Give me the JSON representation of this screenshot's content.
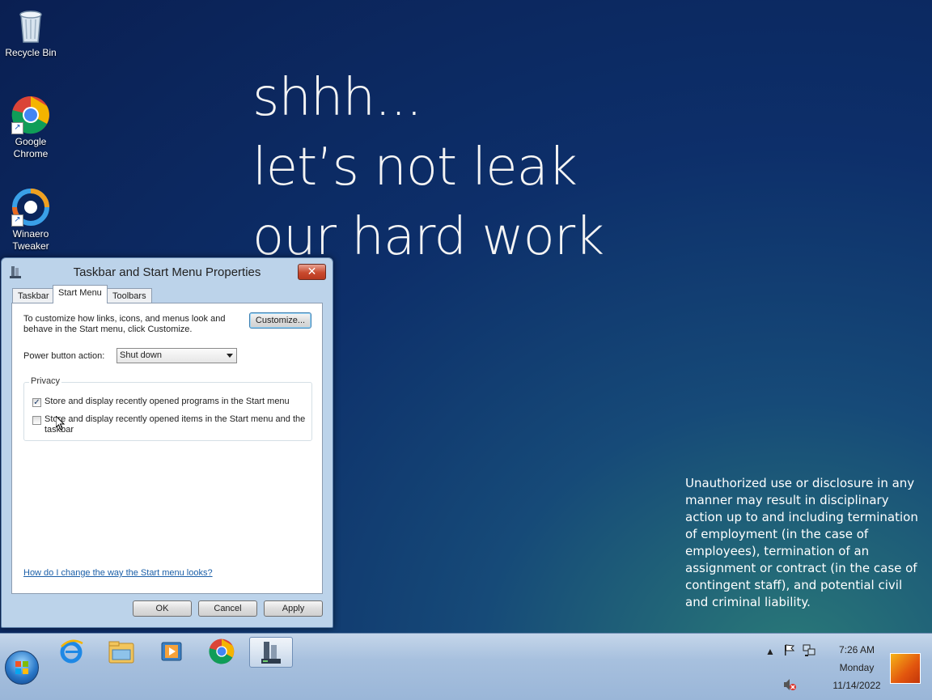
{
  "desktop": {
    "icons": [
      {
        "label": "Recycle Bin",
        "icon": "recycle-bin-icon"
      },
      {
        "label": "Google Chrome",
        "icon": "chrome-icon"
      },
      {
        "label": "Winaero Tweaker",
        "icon": "winaero-tweaker-icon"
      }
    ],
    "wallpaper_lines": [
      "shhh...",
      "let’s not leak",
      "our hard work"
    ],
    "notice": "Unauthorized use or disclosure in any manner may result in disciplinary action up to and including termination of employment (in the case of employees), termination of an assignment or contract (in the case of contingent staff), and potential civil and criminal liability."
  },
  "dialog": {
    "title": "Taskbar and Start Menu Properties",
    "close_label": "✕",
    "tabs": [
      {
        "label": "Taskbar",
        "active": false
      },
      {
        "label": "Start Menu",
        "active": true
      },
      {
        "label": "Toolbars",
        "active": false
      }
    ],
    "description": "To customize how links, icons, and menus look and behave in the Start menu, click Customize.",
    "customize_label": "Customize...",
    "power_label": "Power button action:",
    "power_value": "Shut down",
    "privacy": {
      "title": "Privacy",
      "items": [
        {
          "label": "Store and display recently opened programs in the Start menu",
          "checked": true
        },
        {
          "label": "Store and display recently opened items in the Start menu and the taskbar",
          "checked": false
        }
      ]
    },
    "help_link": "How do I change the way the Start menu looks?",
    "buttons": {
      "ok": "OK",
      "cancel": "Cancel",
      "apply": "Apply"
    }
  },
  "taskbar": {
    "pinned": [
      "internet-explorer-icon",
      "file-explorer-icon",
      "media-player-icon",
      "chrome-icon",
      "taskbar-properties-icon"
    ],
    "tray": {
      "time": "7:26 AM",
      "day": "Monday",
      "date": "11/14/2022",
      "icons": [
        "show-hidden-icons",
        "action-center-flag-icon",
        "network-icon",
        "volume-muted-icon"
      ]
    }
  }
}
